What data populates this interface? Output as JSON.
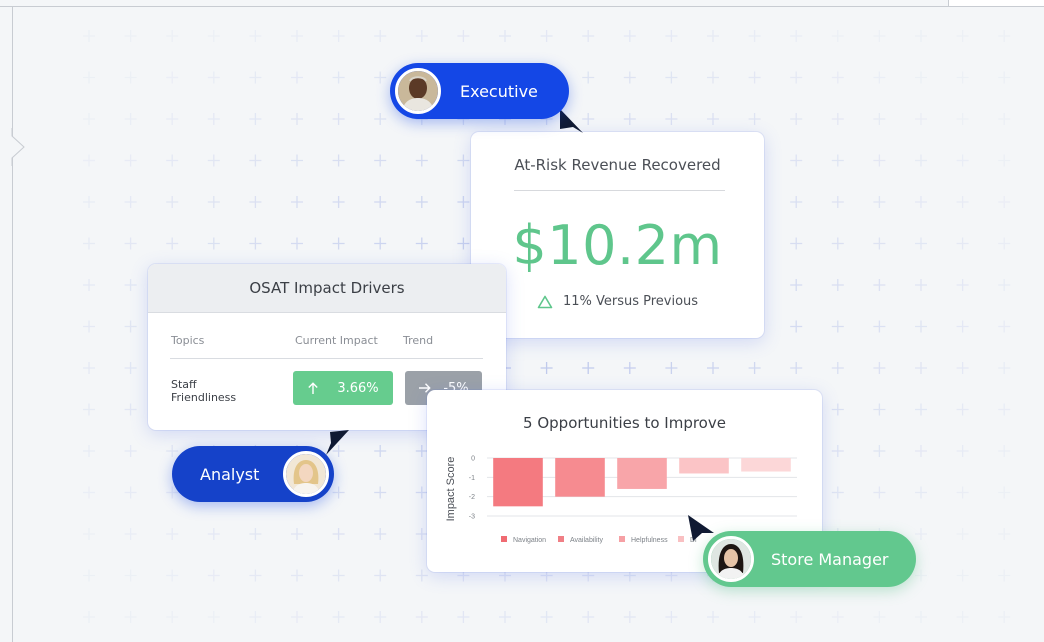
{
  "colors": {
    "brand_blue": "#1447e6",
    "success_green": "#5fc68c",
    "grid_plus": "#b7c2ea"
  },
  "revenue_card": {
    "title": "At-Risk Revenue Recovered",
    "value": "$10.2m",
    "change_text": "11% Versus Previous",
    "change_icon": "triangle-up-outline-icon"
  },
  "osat_card": {
    "title": "OSAT Impact Drivers",
    "columns": [
      "Topics",
      "Current Impact",
      "Trend"
    ],
    "rows": [
      {
        "topic": "Staff Friendliness",
        "current_impact": "3.66%",
        "current_impact_icon": "arrow-up-icon",
        "trend": "-5%",
        "trend_icon": "arrow-right-icon"
      }
    ]
  },
  "opportunities_card": {
    "title": "5 Opportunities to Improve"
  },
  "chart_data": {
    "type": "bar",
    "ylabel": "Impact Score",
    "ylim": [
      -3,
      0
    ],
    "yticks": [
      "0",
      "-1",
      "-2",
      "-3"
    ],
    "categories": [
      "Navigation",
      "Availability",
      "Helpfulness",
      "Di",
      ""
    ],
    "values": [
      -2.5,
      -2.0,
      -1.6,
      -0.8,
      -0.7
    ],
    "bar_colors": [
      "#f47a80",
      "#f68b90",
      "#f8a5a9",
      "#fbc4c6",
      "#fcd7d8"
    ],
    "legend_placement": "bottom",
    "legend_colors": [
      "#f06b72",
      "#f07f85",
      "#f6a0a4",
      "#f9c0c2"
    ],
    "grid": true
  },
  "personas": {
    "executive": {
      "label": "Executive",
      "avatar_icon": "executive-avatar"
    },
    "analyst": {
      "label": "Analyst",
      "avatar_icon": "analyst-avatar"
    },
    "store_manager": {
      "label": "Store Manager",
      "avatar_icon": "store-manager-avatar"
    }
  }
}
